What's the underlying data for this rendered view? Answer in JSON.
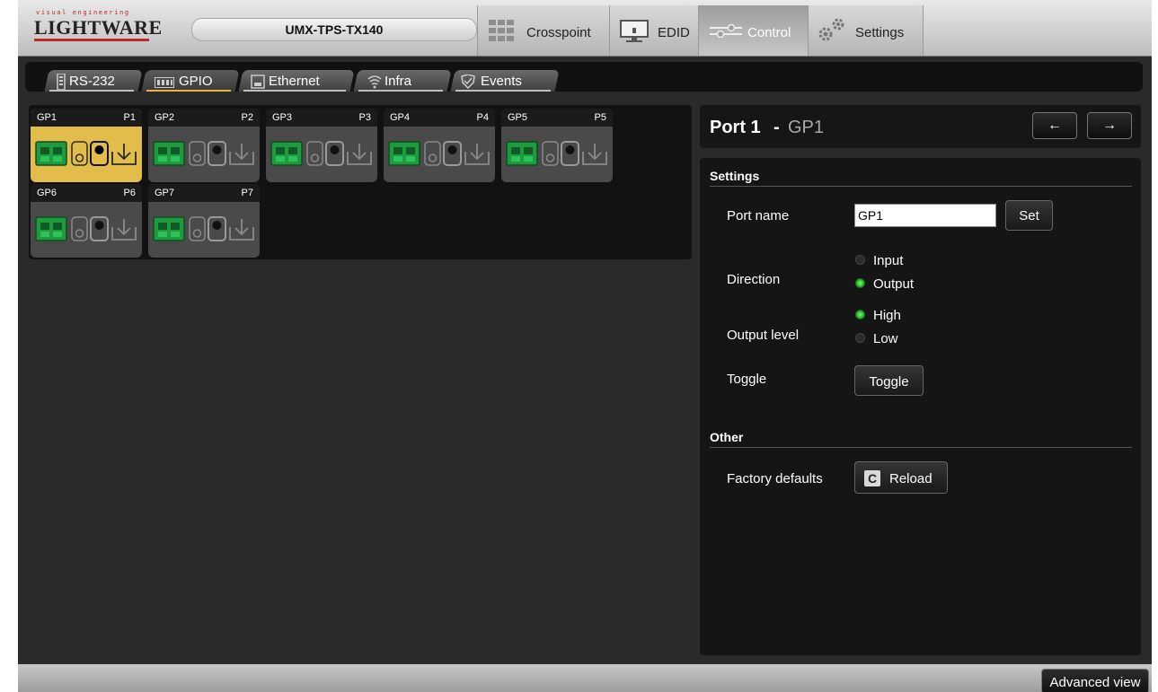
{
  "header": {
    "logo_tagline": "visual engineering",
    "logo_name": "LIGHTWARE",
    "device_name": "UMX-TPS-TX140",
    "nav": [
      {
        "label": "Crosspoint",
        "icon": "grid-icon"
      },
      {
        "label": "EDID",
        "icon": "monitor-icon"
      },
      {
        "label": "Control",
        "icon": "sliders-icon",
        "active": true
      },
      {
        "label": "Settings",
        "icon": "gears-icon"
      }
    ]
  },
  "subtabs": [
    {
      "label": "RS-232",
      "icon": "serial-icon"
    },
    {
      "label": "GPIO",
      "icon": "gpio-icon",
      "active": true
    },
    {
      "label": "Ethernet",
      "icon": "ethernet-icon"
    },
    {
      "label": "Infra",
      "icon": "wifi-icon"
    },
    {
      "label": "Events",
      "icon": "shield-check-icon"
    }
  ],
  "ports": [
    {
      "name": "GP1",
      "id": "P1",
      "selected": true
    },
    {
      "name": "GP2",
      "id": "P2"
    },
    {
      "name": "GP3",
      "id": "P3"
    },
    {
      "name": "GP4",
      "id": "P4"
    },
    {
      "name": "GP5",
      "id": "P5"
    },
    {
      "name": "GP6",
      "id": "P6"
    },
    {
      "name": "GP7",
      "id": "P7"
    }
  ],
  "details": {
    "title_port": "Port 1",
    "title_sep": "-",
    "title_name": "GP1",
    "prev_label": "←",
    "next_label": "→",
    "settings_heading": "Settings",
    "port_name_label": "Port name",
    "port_name_value": "GP1",
    "set_label": "Set",
    "direction_label": "Direction",
    "direction_options": [
      {
        "label": "Input",
        "selected": false
      },
      {
        "label": "Output",
        "selected": true
      }
    ],
    "output_level_label": "Output level",
    "output_level_options": [
      {
        "label": "High",
        "selected": true
      },
      {
        "label": "Low",
        "selected": false
      }
    ],
    "toggle_label": "Toggle",
    "toggle_button": "Toggle",
    "other_heading": "Other",
    "factory_label": "Factory defaults",
    "reload_label": "Reload",
    "reload_icon_letter": "C"
  },
  "footer": {
    "advanced_view": "Advanced view"
  },
  "colors": {
    "selected_port": "#e2bd4b",
    "radio_on": "#2ec82e",
    "connector_green": "#1f9a3f",
    "logo_red": "#c0272d"
  }
}
